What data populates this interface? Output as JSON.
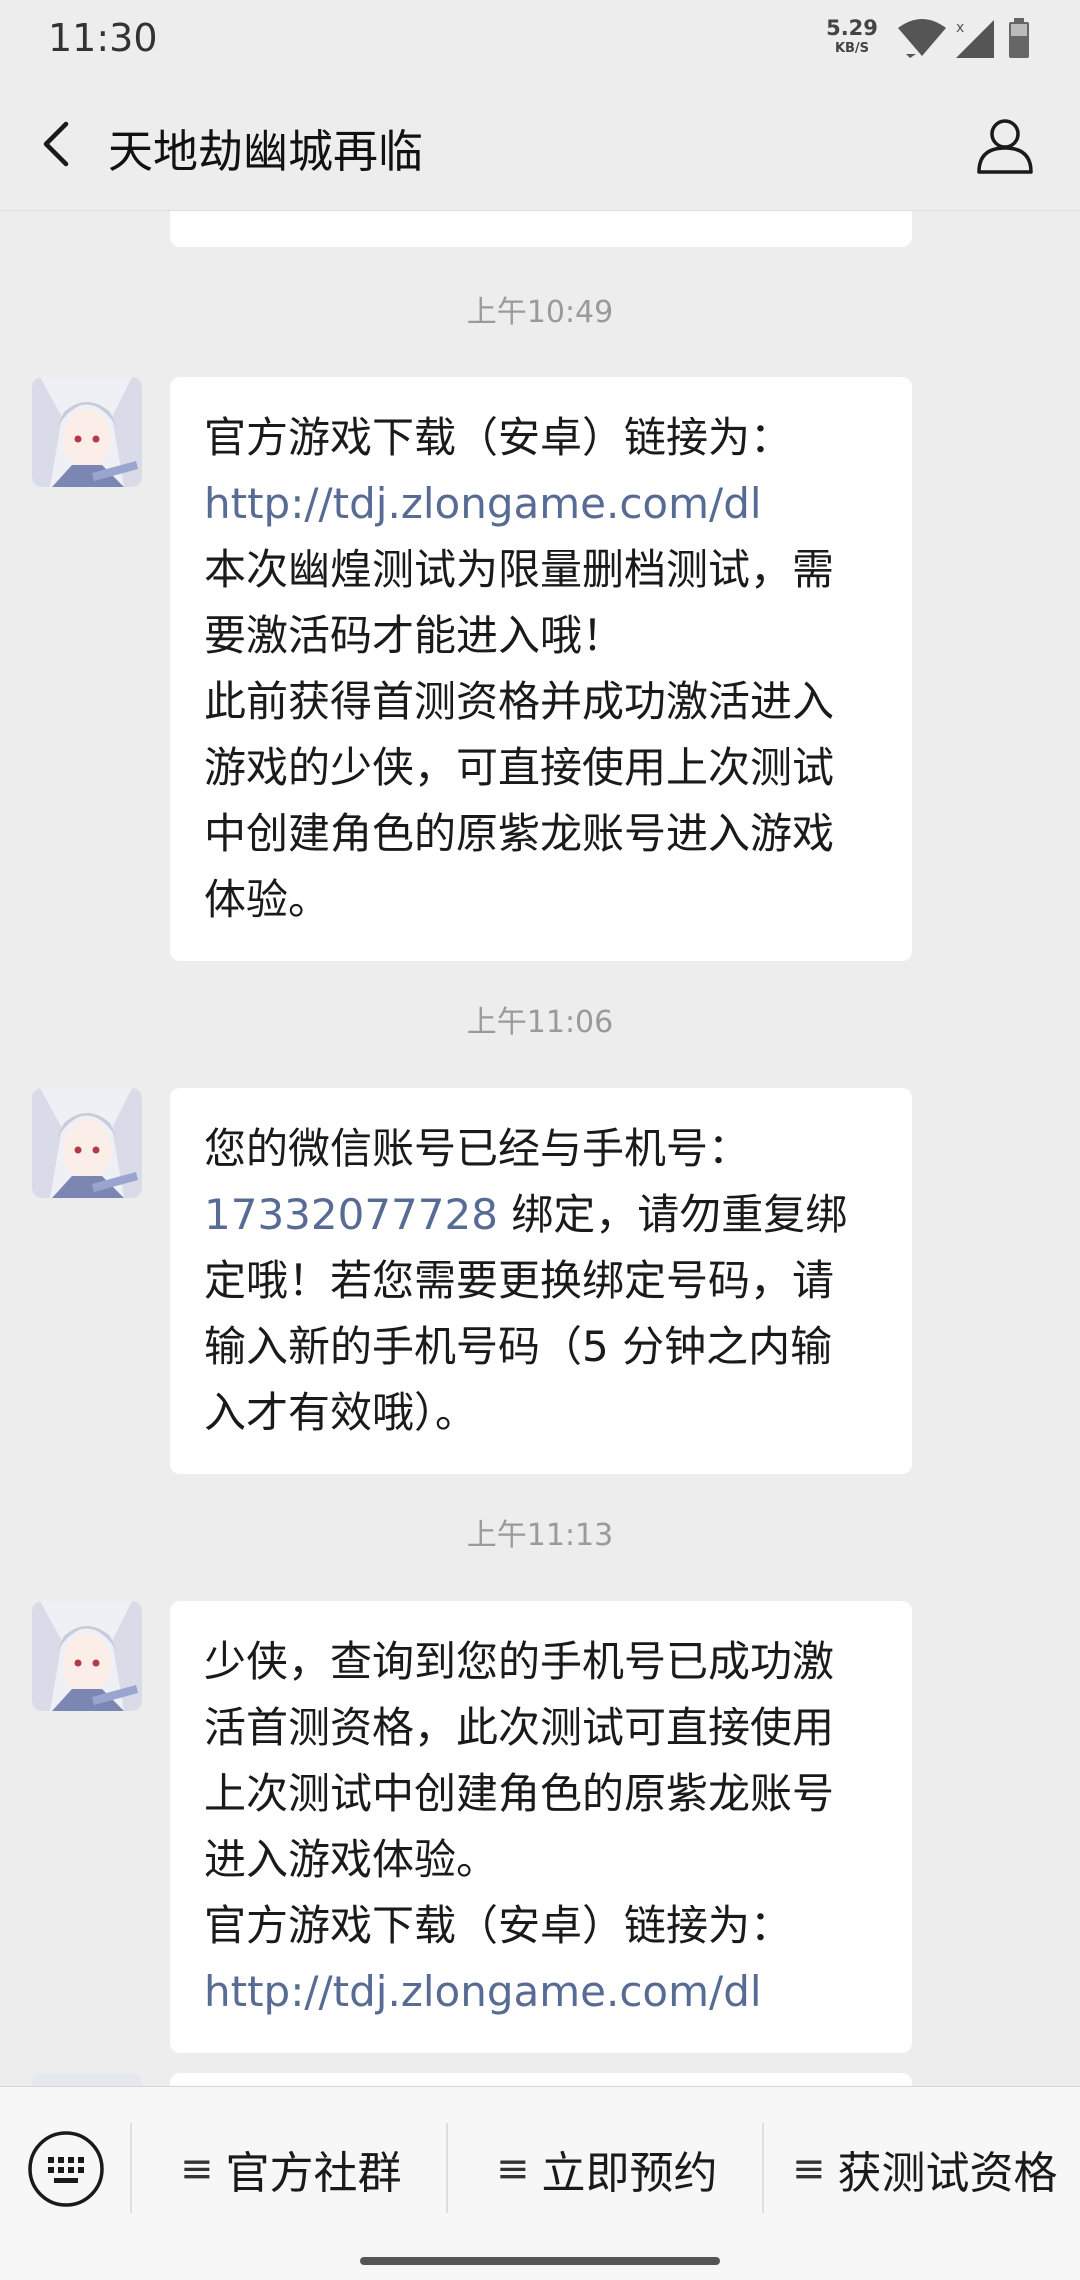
{
  "status": {
    "time": "11:30",
    "speed_value": "5.29",
    "speed_unit": "KB/S"
  },
  "header": {
    "title": "天地劫幽城再临",
    "back_icon": "chevron-left-icon",
    "profile_icon": "person-icon"
  },
  "messages": [
    {
      "time": "上午10:49",
      "lines": [
        {
          "text": "官方游戏下载（安卓）链接为：",
          "link": false
        },
        {
          "text": "http://tdj.zlongame.com/dl",
          "link": true
        },
        {
          "text": "本次幽煌测试为限量删档测试，需",
          "link": false
        },
        {
          "text": "要激活码才能进入哦！",
          "link": false
        },
        {
          "text": "此前获得首测资格并成功激活进入",
          "link": false
        },
        {
          "text": "游戏的少侠，可直接使用上次测试",
          "link": false
        },
        {
          "text": "中创建角色的原紫龙账号进入游戏",
          "link": false
        },
        {
          "text": "体验。",
          "link": false
        }
      ]
    },
    {
      "time": "上午11:06",
      "lines": [
        {
          "text": "您的微信账号已经与手机号：",
          "link": false
        },
        {
          "link_part": "17332077728",
          "rest": " 绑定，请勿重复绑"
        },
        {
          "text": "定哦！若您需要更换绑定号码，请",
          "link": false
        },
        {
          "text": "输入新的手机号码（5 分钟之内输",
          "link": false
        },
        {
          "text": "入才有效哦）。",
          "link": false
        }
      ]
    },
    {
      "time": "上午11:13",
      "lines": [
        {
          "text": "少侠，查询到您的手机号已成功激",
          "link": false
        },
        {
          "text": "活首测资格，此次测试可直接使用",
          "link": false
        },
        {
          "text": "上次测试中创建角色的原紫龙账号",
          "link": false
        },
        {
          "text": "进入游戏体验。",
          "link": false
        },
        {
          "text": "官方游戏下载（安卓）链接为：",
          "link": false
        },
        {
          "text": "http://tdj.zlongame.com/dl",
          "link": true
        }
      ]
    }
  ],
  "menu": {
    "keyboard_icon": "keyboard-icon",
    "items": [
      {
        "label": "官方社群"
      },
      {
        "label": "立即预约"
      },
      {
        "label": "获测试资格"
      }
    ],
    "item_icon": "≡"
  }
}
